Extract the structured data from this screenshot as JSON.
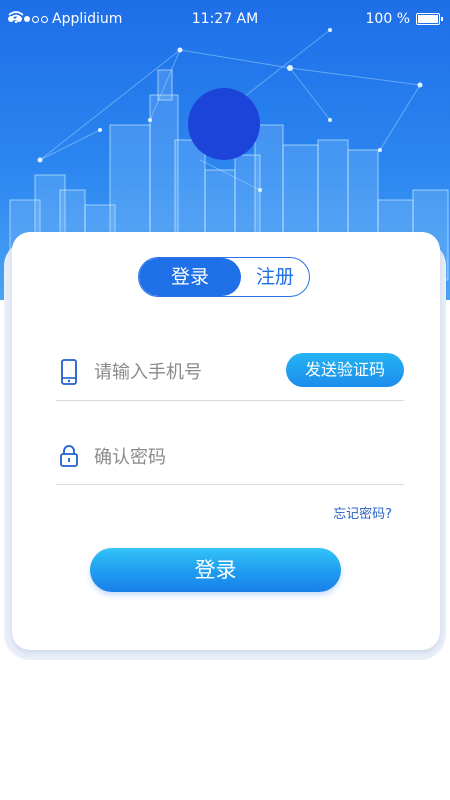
{
  "status_bar": {
    "carrier": "Applidium",
    "time": "11:27 AM",
    "battery": "100 %"
  },
  "tabs": {
    "login": "登录",
    "register": "注册",
    "active": "login"
  },
  "form": {
    "phone_placeholder": "请输入手机号",
    "send_code_label": "发送验证码",
    "code_placeholder": "确认密码",
    "forgot_label": "忘记密码?",
    "submit_label": "登录"
  },
  "colors": {
    "primary": "#1f6fe6",
    "button_gradient_top": "#33c4f7",
    "button_gradient_bottom": "#1980ea",
    "avatar": "#1d44d8"
  },
  "icons": {
    "phone_field": "phone-icon",
    "code_field": "lock-icon",
    "wifi": "wifi-icon"
  }
}
